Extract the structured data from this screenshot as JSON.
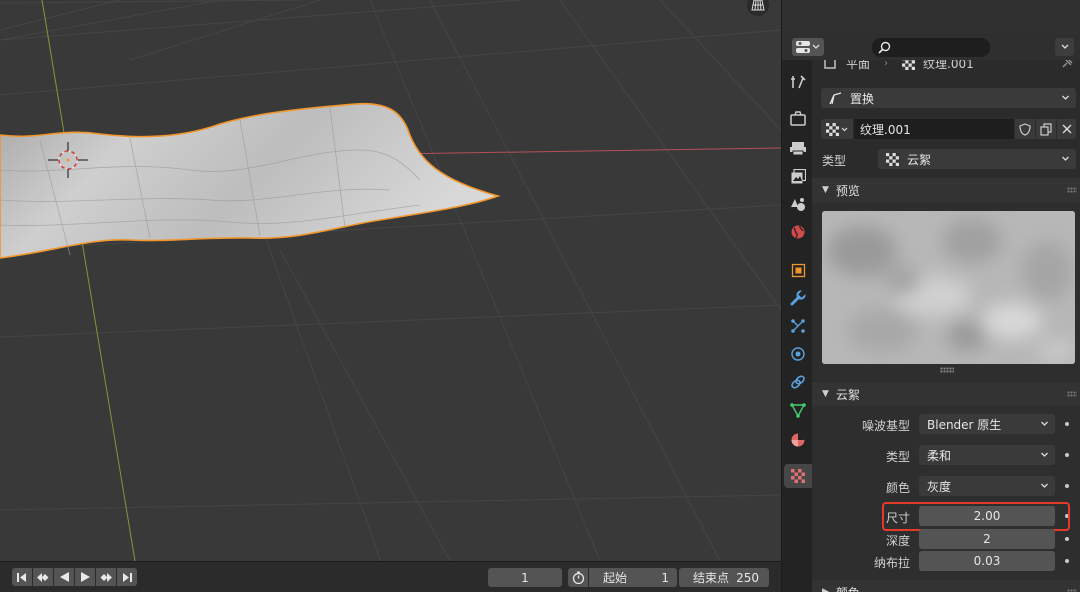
{
  "viewport": {
    "perspective_icon": "perspective-grid-icon"
  },
  "timeline": {
    "current_frame": "1",
    "start_label": "起始",
    "start_value": "1",
    "end_label": "结束点",
    "end_value": "250",
    "playback_icons": [
      "jump-start-icon",
      "prev-keyframe-icon",
      "play-reverse-icon",
      "play-icon",
      "next-keyframe-icon",
      "jump-end-icon"
    ]
  },
  "properties": {
    "search_placeholder": "",
    "context_path": {
      "object": "平面",
      "texture": "纹理.001"
    },
    "texture_slot": "置换",
    "texture_name": "纹理.001",
    "type_label": "类型",
    "type_value": "云絮",
    "preview_header": "预览",
    "clouds_header": "云絮",
    "noise_basis_label": "噪波基型",
    "noise_basis_value": "Blender 原生",
    "noise_type_label": "类型",
    "noise_type_value": "柔和",
    "color_label": "颜色",
    "color_value": "灰度",
    "size_label": "尺寸",
    "size_value": "2.00",
    "depth_label": "深度",
    "depth_value": "2",
    "nabla_label": "纳布拉",
    "nabla_value": "0.03",
    "colors_header": "颜色"
  },
  "colors": {
    "selection_outline": "#f0962d",
    "highlight_box": "#e53a2a",
    "x_axis": "#b5505c",
    "y_axis": "#7e9a3a"
  }
}
